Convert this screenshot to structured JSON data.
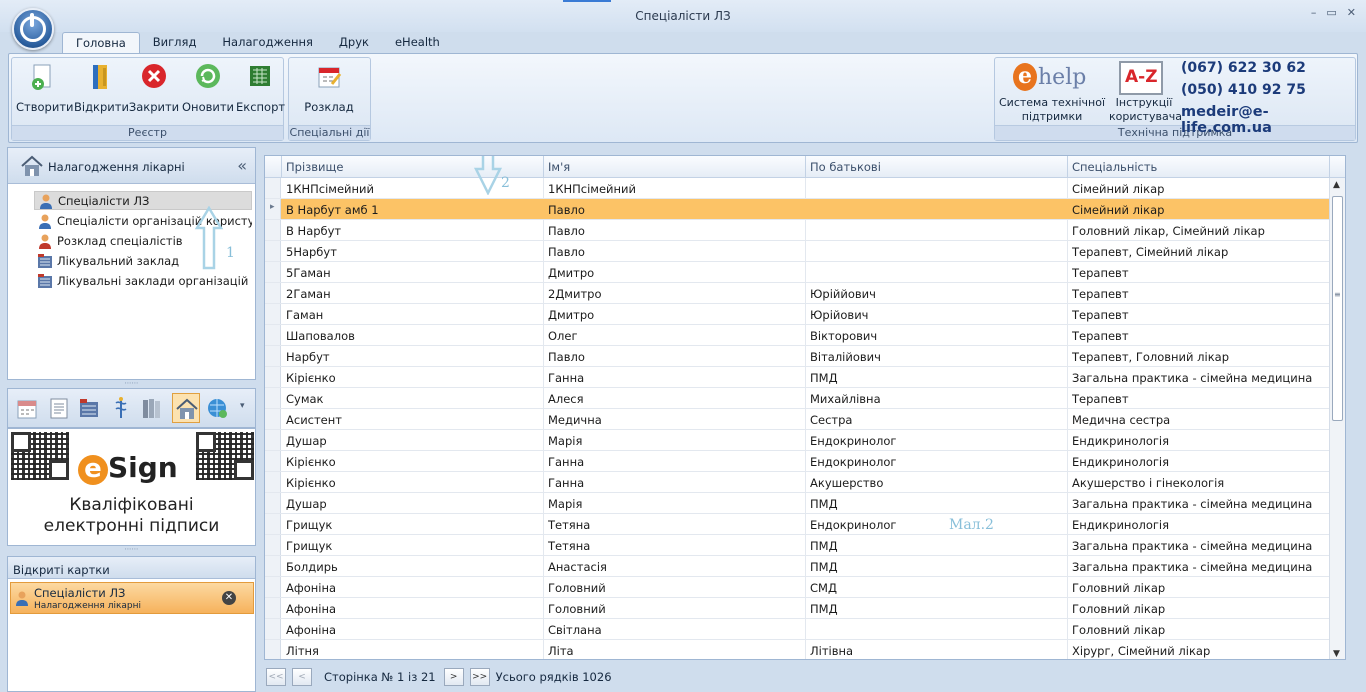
{
  "window": {
    "title": "Спеціалісти ЛЗ",
    "controls": [
      "–",
      "▭",
      "✕"
    ]
  },
  "tabs": [
    {
      "label": "Головна",
      "active": true
    },
    {
      "label": "Вигляд",
      "active": false
    },
    {
      "label": "Налагодження",
      "active": false
    },
    {
      "label": "Друк",
      "active": false
    },
    {
      "label": "eHealth",
      "active": false
    }
  ],
  "ribbon": {
    "registry": {
      "label": "Реєстр",
      "buttons": [
        {
          "label": "Створити",
          "icon": "create-icon"
        },
        {
          "label": "Відкрити",
          "icon": "open-icon"
        },
        {
          "label": "Закрити",
          "icon": "close-icon"
        },
        {
          "label": "Оновити",
          "icon": "refresh-icon"
        },
        {
          "label": "Експорт",
          "icon": "export-icon"
        }
      ]
    },
    "special": {
      "label": "Спеціальні дії",
      "schedule_label": "Розклад"
    },
    "support": {
      "label": "Технічна підтримка",
      "help_logo": "help",
      "system_label_1": "Система технічної",
      "system_label_2": "підтримки",
      "az_label": "A-Z",
      "instructions_label_1": "Інструкції",
      "instructions_label_2": "користувача",
      "phone1": "(067) 622 30 62",
      "phone2": "(050) 410 92 75",
      "email": "medeir@e-life.com.ua"
    }
  },
  "left_panel": {
    "title": "Налагодження лікарні",
    "items": [
      {
        "label": "Спеціалісти ЛЗ",
        "selected": true
      },
      {
        "label": "Спеціалісти організацій користувача",
        "selected": false
      },
      {
        "label": "Розклад спеціалістів",
        "selected": false
      },
      {
        "label": "Лікувальний заклад",
        "selected": false
      },
      {
        "label": "Лікувальні заклади організацій користувача",
        "selected": false
      }
    ]
  },
  "esign": {
    "brand": "Sign",
    "caption_1": "Кваліфіковані",
    "caption_2": "електронні підписи"
  },
  "open_cards": {
    "title": "Відкриті картки",
    "card": {
      "title": "Спеціалісти ЛЗ",
      "subtitle": "Налагодження лікарні"
    }
  },
  "grid": {
    "columns": [
      "Прізвище",
      "Ім'я",
      "По батькові",
      "Спеціальність"
    ],
    "rows": [
      [
        "1КНПсімейний",
        "1КНПсімейний",
        "",
        "Сімейний лікар"
      ],
      [
        "В Нарбут амб 1",
        "Павло",
        "",
        "Сімейний лікар"
      ],
      [
        "В Нарбут",
        "Павло",
        "",
        "Головний лікар, Сімейний лікар"
      ],
      [
        "5Нарбут",
        "Павло",
        "",
        "Терапевт, Сімейний лікар"
      ],
      [
        "5Гаман",
        "Дмитро",
        "",
        "Терапевт"
      ],
      [
        "2Гаман",
        "2Дмитро",
        "Юріййович",
        "Терапевт"
      ],
      [
        "Гаман",
        "Дмитро",
        "Юрійович",
        "Терапевт"
      ],
      [
        "Шаповалов",
        "Олег",
        "Вікторович",
        "Терапевт"
      ],
      [
        "Нарбут",
        "Павло",
        "Віталійович",
        "Терапевт, Головний лікар"
      ],
      [
        "Кірієнко",
        "Ганна",
        "ПМД",
        "Загальна практика - сімейна медицина"
      ],
      [
        "Сумак",
        "Алеся",
        "Михайлівна",
        "Терапевт"
      ],
      [
        "Асистент",
        "Медична",
        "Сестра",
        "Медична сестра"
      ],
      [
        "Душар",
        "Марія",
        "Ендокринолог",
        "Ендикринологія"
      ],
      [
        "Кірієнко",
        "Ганна",
        "Ендокринолог",
        "Ендикринологія"
      ],
      [
        "Кірієнко",
        "Ганна",
        "Акушерство",
        "Акушерство і гінекологія"
      ],
      [
        "Душар",
        "Марія",
        "ПМД",
        "Загальна практика - сімейна медицина"
      ],
      [
        "Грищук",
        "Тетяна",
        "Ендокринолог",
        "Ендикринологія"
      ],
      [
        "Грищук",
        "Тетяна",
        "ПМД",
        "Загальна практика - сімейна медицина"
      ],
      [
        "Болдирь",
        "Анастасія",
        "ПМД",
        "Загальна практика - сімейна медицина"
      ],
      [
        "Афоніна",
        "Головний",
        "СМД",
        "Головний лікар"
      ],
      [
        "Афоніна",
        "Головний",
        "ПМД",
        "Головний лікар"
      ],
      [
        "Афоніна",
        "Світлана",
        "",
        "Головний лікар"
      ],
      [
        "Літня",
        "Літа",
        "Літівна",
        "Хірург, Сімейний лікар"
      ]
    ],
    "selected_row": 1
  },
  "pager": {
    "first": "<<",
    "prev": "<",
    "page_text": "Сторінка № 1 із 21",
    "next": ">",
    "last": ">>",
    "total": "Усього рядків 1026"
  },
  "annotations": {
    "n1": "1",
    "n2": "2",
    "fig": "Мал.2"
  },
  "colors": {
    "selection": "#fcc366",
    "accent": "#3a7bd5",
    "annotation": "#88bfd9"
  }
}
